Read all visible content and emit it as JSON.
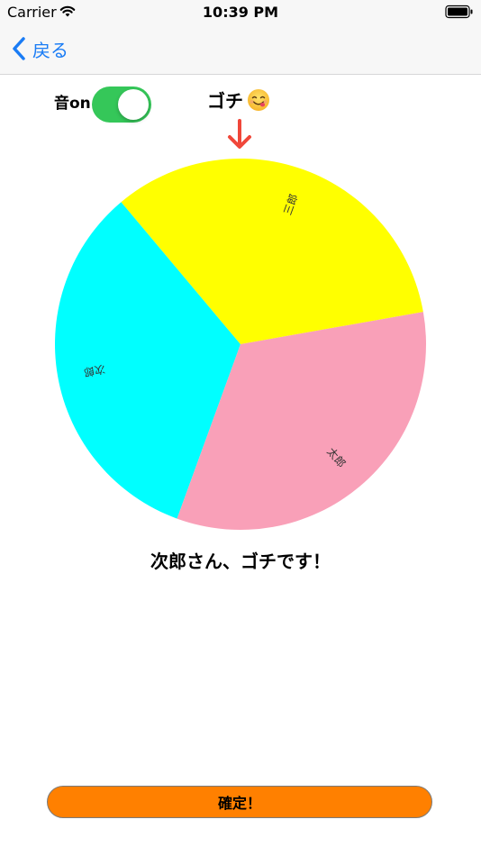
{
  "status_bar": {
    "carrier": "Carrier",
    "time": "10:39 PM"
  },
  "nav": {
    "back_label": "戻る"
  },
  "controls": {
    "sound_label": "音on",
    "sound_on": true
  },
  "title": {
    "text": "ゴチ",
    "emoji": "savoring-food-emoji"
  },
  "roulette": {
    "segments": [
      {
        "label": "次郎",
        "color": "#00ffff",
        "fraction": 0.3333
      },
      {
        "label": "三郎",
        "color": "#ffff00",
        "fraction": 0.3333
      },
      {
        "label": "太郎",
        "color": "#f9a0b8",
        "fraction": 0.3334
      }
    ]
  },
  "result": {
    "text": "次郎さん、ゴチです！"
  },
  "confirm": {
    "label": "確定！"
  },
  "colors": {
    "accent_blue": "#1a7cf5",
    "toggle_green": "#35c759",
    "arrow_red": "#f0473a",
    "confirm_orange": "#ff8000"
  }
}
